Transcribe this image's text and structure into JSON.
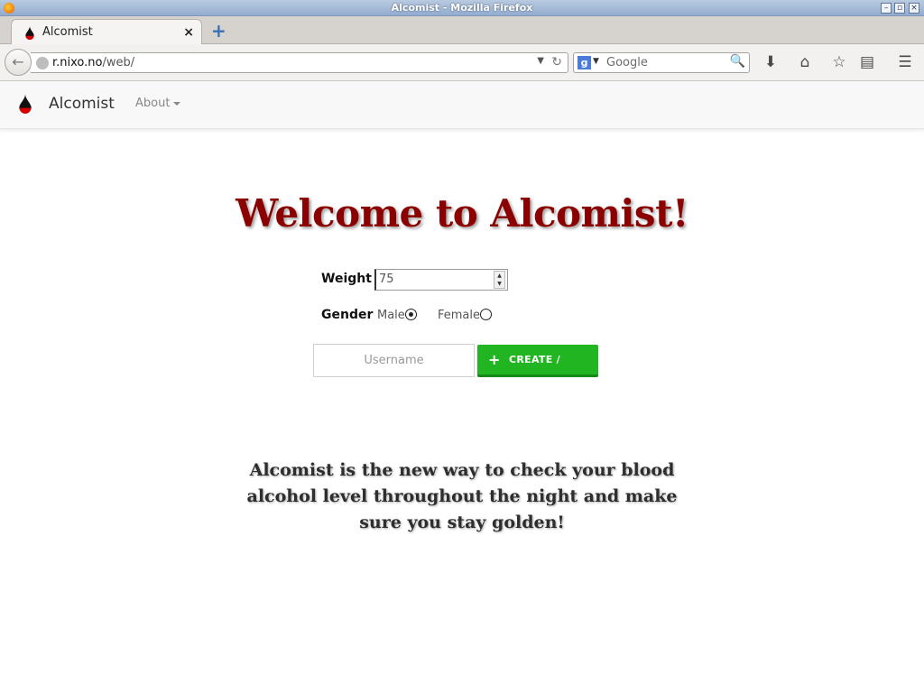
{
  "window": {
    "title": "Alcomist - Mozilla Firefox"
  },
  "browser": {
    "tab_label": "Alcomist",
    "url_host": "r.nixo.no",
    "url_path": "/web/",
    "search_placeholder": "Google",
    "search_engine_letter": "g"
  },
  "site": {
    "brand": "Alcomist",
    "nav_about": "About",
    "brand_color": "#8b0000",
    "accent_green": "#22b522"
  },
  "form": {
    "heading": "Welcome to Alcomist!",
    "weight_label": "Weight",
    "weight_value": "75",
    "gender_label": "Gender",
    "gender_options": [
      {
        "label": "Male",
        "selected": true
      },
      {
        "label": "Female",
        "selected": false
      }
    ],
    "username_placeholder": "Username",
    "submit_label": "CREATE / LOGIN"
  },
  "tagline": "Alcomist is the new way to check your blood alcohol level throughout the night and make sure you stay golden!"
}
